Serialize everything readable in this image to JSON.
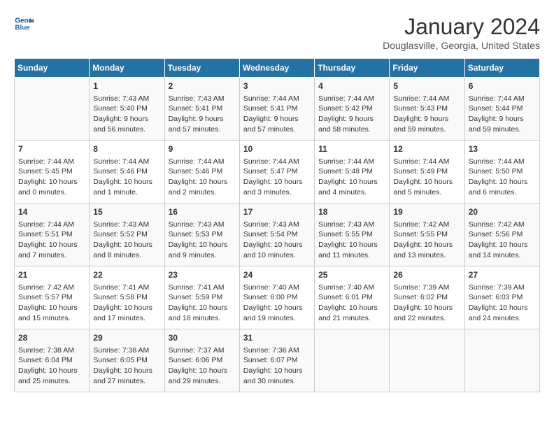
{
  "header": {
    "logo_text_general": "General",
    "logo_text_blue": "Blue",
    "month_title": "January 2024",
    "location": "Douglasville, Georgia, United States"
  },
  "weekdays": [
    "Sunday",
    "Monday",
    "Tuesday",
    "Wednesday",
    "Thursday",
    "Friday",
    "Saturday"
  ],
  "weeks": [
    [
      {
        "day": "",
        "info": ""
      },
      {
        "day": "1",
        "info": "Sunrise: 7:43 AM\nSunset: 5:40 PM\nDaylight: 9 hours\nand 56 minutes."
      },
      {
        "day": "2",
        "info": "Sunrise: 7:43 AM\nSunset: 5:41 PM\nDaylight: 9 hours\nand 57 minutes."
      },
      {
        "day": "3",
        "info": "Sunrise: 7:44 AM\nSunset: 5:41 PM\nDaylight: 9 hours\nand 57 minutes."
      },
      {
        "day": "4",
        "info": "Sunrise: 7:44 AM\nSunset: 5:42 PM\nDaylight: 9 hours\nand 58 minutes."
      },
      {
        "day": "5",
        "info": "Sunrise: 7:44 AM\nSunset: 5:43 PM\nDaylight: 9 hours\nand 59 minutes."
      },
      {
        "day": "6",
        "info": "Sunrise: 7:44 AM\nSunset: 5:44 PM\nDaylight: 9 hours\nand 59 minutes."
      }
    ],
    [
      {
        "day": "7",
        "info": "Sunrise: 7:44 AM\nSunset: 5:45 PM\nDaylight: 10 hours\nand 0 minutes."
      },
      {
        "day": "8",
        "info": "Sunrise: 7:44 AM\nSunset: 5:46 PM\nDaylight: 10 hours\nand 1 minute."
      },
      {
        "day": "9",
        "info": "Sunrise: 7:44 AM\nSunset: 5:46 PM\nDaylight: 10 hours\nand 2 minutes."
      },
      {
        "day": "10",
        "info": "Sunrise: 7:44 AM\nSunset: 5:47 PM\nDaylight: 10 hours\nand 3 minutes."
      },
      {
        "day": "11",
        "info": "Sunrise: 7:44 AM\nSunset: 5:48 PM\nDaylight: 10 hours\nand 4 minutes."
      },
      {
        "day": "12",
        "info": "Sunrise: 7:44 AM\nSunset: 5:49 PM\nDaylight: 10 hours\nand 5 minutes."
      },
      {
        "day": "13",
        "info": "Sunrise: 7:44 AM\nSunset: 5:50 PM\nDaylight: 10 hours\nand 6 minutes."
      }
    ],
    [
      {
        "day": "14",
        "info": "Sunrise: 7:44 AM\nSunset: 5:51 PM\nDaylight: 10 hours\nand 7 minutes."
      },
      {
        "day": "15",
        "info": "Sunrise: 7:43 AM\nSunset: 5:52 PM\nDaylight: 10 hours\nand 8 minutes."
      },
      {
        "day": "16",
        "info": "Sunrise: 7:43 AM\nSunset: 5:53 PM\nDaylight: 10 hours\nand 9 minutes."
      },
      {
        "day": "17",
        "info": "Sunrise: 7:43 AM\nSunset: 5:54 PM\nDaylight: 10 hours\nand 10 minutes."
      },
      {
        "day": "18",
        "info": "Sunrise: 7:43 AM\nSunset: 5:55 PM\nDaylight: 10 hours\nand 11 minutes."
      },
      {
        "day": "19",
        "info": "Sunrise: 7:42 AM\nSunset: 5:55 PM\nDaylight: 10 hours\nand 13 minutes."
      },
      {
        "day": "20",
        "info": "Sunrise: 7:42 AM\nSunset: 5:56 PM\nDaylight: 10 hours\nand 14 minutes."
      }
    ],
    [
      {
        "day": "21",
        "info": "Sunrise: 7:42 AM\nSunset: 5:57 PM\nDaylight: 10 hours\nand 15 minutes."
      },
      {
        "day": "22",
        "info": "Sunrise: 7:41 AM\nSunset: 5:58 PM\nDaylight: 10 hours\nand 17 minutes."
      },
      {
        "day": "23",
        "info": "Sunrise: 7:41 AM\nSunset: 5:59 PM\nDaylight: 10 hours\nand 18 minutes."
      },
      {
        "day": "24",
        "info": "Sunrise: 7:40 AM\nSunset: 6:00 PM\nDaylight: 10 hours\nand 19 minutes."
      },
      {
        "day": "25",
        "info": "Sunrise: 7:40 AM\nSunset: 6:01 PM\nDaylight: 10 hours\nand 21 minutes."
      },
      {
        "day": "26",
        "info": "Sunrise: 7:39 AM\nSunset: 6:02 PM\nDaylight: 10 hours\nand 22 minutes."
      },
      {
        "day": "27",
        "info": "Sunrise: 7:39 AM\nSunset: 6:03 PM\nDaylight: 10 hours\nand 24 minutes."
      }
    ],
    [
      {
        "day": "28",
        "info": "Sunrise: 7:38 AM\nSunset: 6:04 PM\nDaylight: 10 hours\nand 25 minutes."
      },
      {
        "day": "29",
        "info": "Sunrise: 7:38 AM\nSunset: 6:05 PM\nDaylight: 10 hours\nand 27 minutes."
      },
      {
        "day": "30",
        "info": "Sunrise: 7:37 AM\nSunset: 6:06 PM\nDaylight: 10 hours\nand 29 minutes."
      },
      {
        "day": "31",
        "info": "Sunrise: 7:36 AM\nSunset: 6:07 PM\nDaylight: 10 hours\nand 30 minutes."
      },
      {
        "day": "",
        "info": ""
      },
      {
        "day": "",
        "info": ""
      },
      {
        "day": "",
        "info": ""
      }
    ]
  ]
}
